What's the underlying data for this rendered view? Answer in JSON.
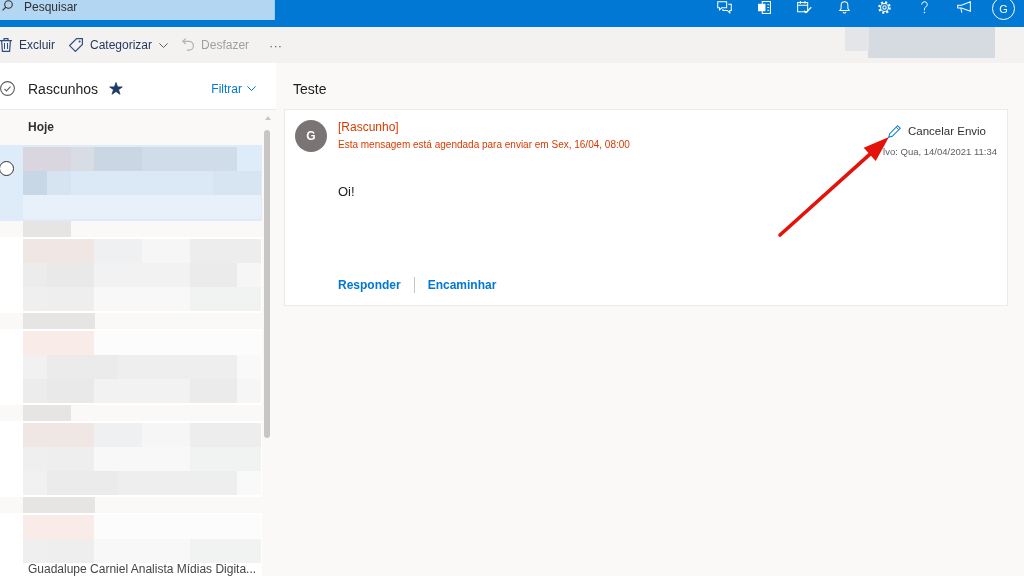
{
  "search": {
    "placeholder": "Pesquisar"
  },
  "account": {
    "initial": "G"
  },
  "toolbar": {
    "buttons": [
      {
        "kind": "delete",
        "label": "Excluir",
        "dropdown": false,
        "disabled": false
      },
      {
        "kind": "categorize",
        "label": "Categorizar",
        "dropdown": true,
        "disabled": false
      },
      {
        "kind": "undo",
        "label": "Desfazer",
        "dropdown": false,
        "disabled": true
      }
    ],
    "more": "···"
  },
  "folder": {
    "title": "Rascunhos",
    "favorite": true,
    "filter": "Filtrar"
  },
  "message_list": {
    "group": "Hoje",
    "messages": [
      {
        "selected": true
      },
      {
        "selected": false
      },
      {
        "selected": false
      },
      {
        "selected": false
      },
      {
        "selected": false,
        "preview": "Guadalupe Carniel Analista Mídias Digita..."
      }
    ]
  },
  "reading_pane": {
    "subject": "Teste",
    "sender_initial": "G",
    "status": "[Rascunho]",
    "schedule_note": "Esta mensagem está agendada para enviar em Sex, 16/04, 08:00",
    "cancel_button": "Cancelar Envio",
    "saved_date": "lvo: Qua, 14/04/2021 11:34",
    "body": "Oi!",
    "actions": [
      "Responder",
      "Encaminhar"
    ]
  }
}
